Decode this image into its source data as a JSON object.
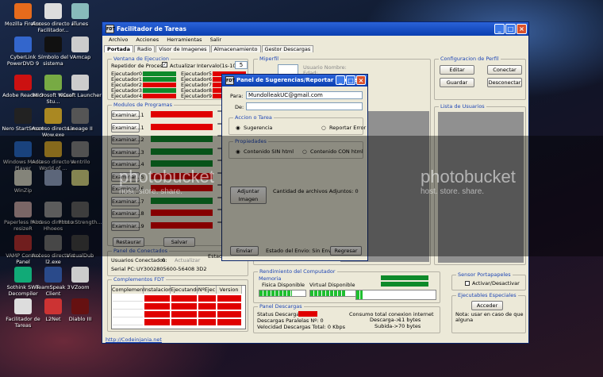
{
  "desktop": [
    {
      "label": "Mozilla Firefox",
      "color": "#e66b1c"
    },
    {
      "label": "Acceso directo a Facilitador...",
      "color": "#ddd"
    },
    {
      "label": "iTunes",
      "color": "#8bb"
    },
    {
      "label": "Proxifier",
      "color": "#58a"
    },
    {
      "label": "Unity",
      "color": "#222"
    },
    {
      "label": "CyberLink PowerDVD 9",
      "color": "#36c"
    },
    {
      "label": "Símbolo del sistema",
      "color": "#111"
    },
    {
      "label": "VAmcap",
      "color": "#ccc"
    },
    {
      "label": "Adobe Reader 9",
      "color": "#c11"
    },
    {
      "label": "Microsoft Visual Stu...",
      "color": "#7a4"
    },
    {
      "label": "NCsoft Launcher",
      "color": "#ccc"
    },
    {
      "label": "Nero StartSmart",
      "color": "#222"
    },
    {
      "label": "Acceso directo a Wow.exe",
      "color": "#a82"
    },
    {
      "label": "Lineage II",
      "color": "#555"
    },
    {
      "label": "Windows Media Player",
      "color": "#2a6fd0"
    },
    {
      "label": "Acceso directo a World of ...",
      "color": "#e0b030"
    },
    {
      "label": "Ventrilo",
      "color": "#888"
    },
    {
      "label": "WinZip",
      "color": "#ddc"
    },
    {
      "label": "",
      "color": "#9ac"
    },
    {
      "label": "",
      "color": "#dd8"
    },
    {
      "label": "Paperless Print resizeR",
      "color": "#caa"
    },
    {
      "label": "Acceso directo a Hhoeos",
      "color": "#999"
    },
    {
      "label": "Photo Strength...",
      "color": "#666"
    },
    {
      "label": "VAMP Control Panel",
      "color": "#b33"
    },
    {
      "label": "Acceso directo a l2.exe",
      "color": "#777"
    },
    {
      "label": "VirtualDub",
      "color": "#444"
    },
    {
      "label": "Sothink SWF Decompiler",
      "color": "#1a7"
    },
    {
      "label": "TeamSpeak 3 Client",
      "color": "#2a4a8a"
    },
    {
      "label": "VZoom",
      "color": "#ccc"
    },
    {
      "label": "Facilitador de Tareas",
      "color": "#ddd"
    },
    {
      "label": "L2Net",
      "color": "#c33"
    },
    {
      "label": "Diablo III",
      "color": "#611"
    }
  ],
  "window": {
    "title": "Facilitador de Tareas",
    "link": "http://Codeinjania.net"
  },
  "menu": [
    "Archivo",
    "Acciones",
    "Herramientas",
    "Salir"
  ],
  "tabs": [
    "Portada",
    "Radio",
    "Visor de Imagenes",
    "Almacenamiento",
    "Gestor Descargas"
  ],
  "ejecucion": {
    "legend": "Ventana de Ejecucion",
    "repetidor": "Repetidor de Proceso",
    "actualizar": "Actualizar",
    "intervalo_label": "Intervalo(1s-10s):",
    "intervalo": "5",
    "left": [
      "Ejecutador0:",
      "Ejecutador1:",
      "Ejecutador2:",
      "Ejecutador3:",
      "Ejecutador4:"
    ],
    "right": [
      "Ejecutador5:",
      "Ejecutador6:",
      "Ejecutador7:",
      "Ejecutador8:",
      "Ejecutador9:"
    ]
  },
  "modulos": {
    "legend": "Modulos de Programas",
    "buttons": [
      "Examinar...1",
      "Examinar...1",
      "Examinar...2",
      "Examinar...3",
      "Examinar...4",
      "Examinar...5",
      "Examinar...6",
      "Examinar...7",
      "Examinar...8",
      "Examinar...9"
    ],
    "restaurar": "Restaurar",
    "salvar": "Salvar"
  },
  "conectados": {
    "legend": "Panel de Conectados",
    "usuarios": "Usuarios Conectados:",
    "usuarios_val": "0",
    "actualizar": "Actualizar",
    "serial": "Serial PC:",
    "serial_val": "UY3002805600-56408 3D2",
    "estado": "Estado S"
  },
  "fdt": {
    "legend": "Complementos FDT",
    "cols": [
      "Complemento",
      "Instalacion",
      "Ejecutando",
      "NºEjec",
      "Version"
    ]
  },
  "miperfil": {
    "legend": "Miperfil",
    "usuario": "Usuario Nombre:",
    "usuario_val": "Edad:"
  },
  "config": {
    "legend": "Configuracion de Perfil",
    "editar": "Editar",
    "conectar": "Conectar",
    "guardar": "Guardar",
    "desconectar": "Desconectar"
  },
  "lista": {
    "legend": "Lista de Usuarios"
  },
  "rendimiento": {
    "legend": "Rendimiento del Computador",
    "memoria": "Memoria",
    "fisica": "Fisica Disponible",
    "virtual": "Virtual Disponible"
  },
  "descargas": {
    "legend": "Panel Descargas",
    "status": "Status Descargas:",
    "paralelas": "Descargas Paralelas Nº: 0",
    "velocidad": "Velocidad Descargas Total: 0 Kbps",
    "consumo": "Consumo total conexion internet",
    "descarga": "Descarga->",
    "descarga_val": "11 bytes",
    "subida": "Subida->",
    "subida_val": "70 bytes"
  },
  "portapapeles": {
    "legend": "Sensor Portapapeles",
    "activar": "Activar/Desactivar"
  },
  "especiales": {
    "legend": "Ejecutables Especiales",
    "acceder": "Acceder",
    "nota": "Nota: usar en caso de que alguna"
  },
  "dialog": {
    "title": "Panel de Sugerencias/Reportar errores",
    "para": "Para:",
    "para_val": "MundolleakUC@gmail.com",
    "de": "De:",
    "accion": "Accion o Tarea",
    "sugerencia": "Sugerencia",
    "reportar": "Reportar Error",
    "propiedades": "Propiedades",
    "sin_html": "Contenido SIN html",
    "con_html": "Contenido CON html",
    "adjuntar": "Adjuntar Imagen",
    "archivos": "Cantidad de archivos Adjuntos: 0",
    "enviar": "Enviar",
    "estado": "Estado del Envio: Sin Enviar...",
    "regresar": "Regresar"
  },
  "watermark": "photobucket",
  "watermark_sub": "host. store. share."
}
